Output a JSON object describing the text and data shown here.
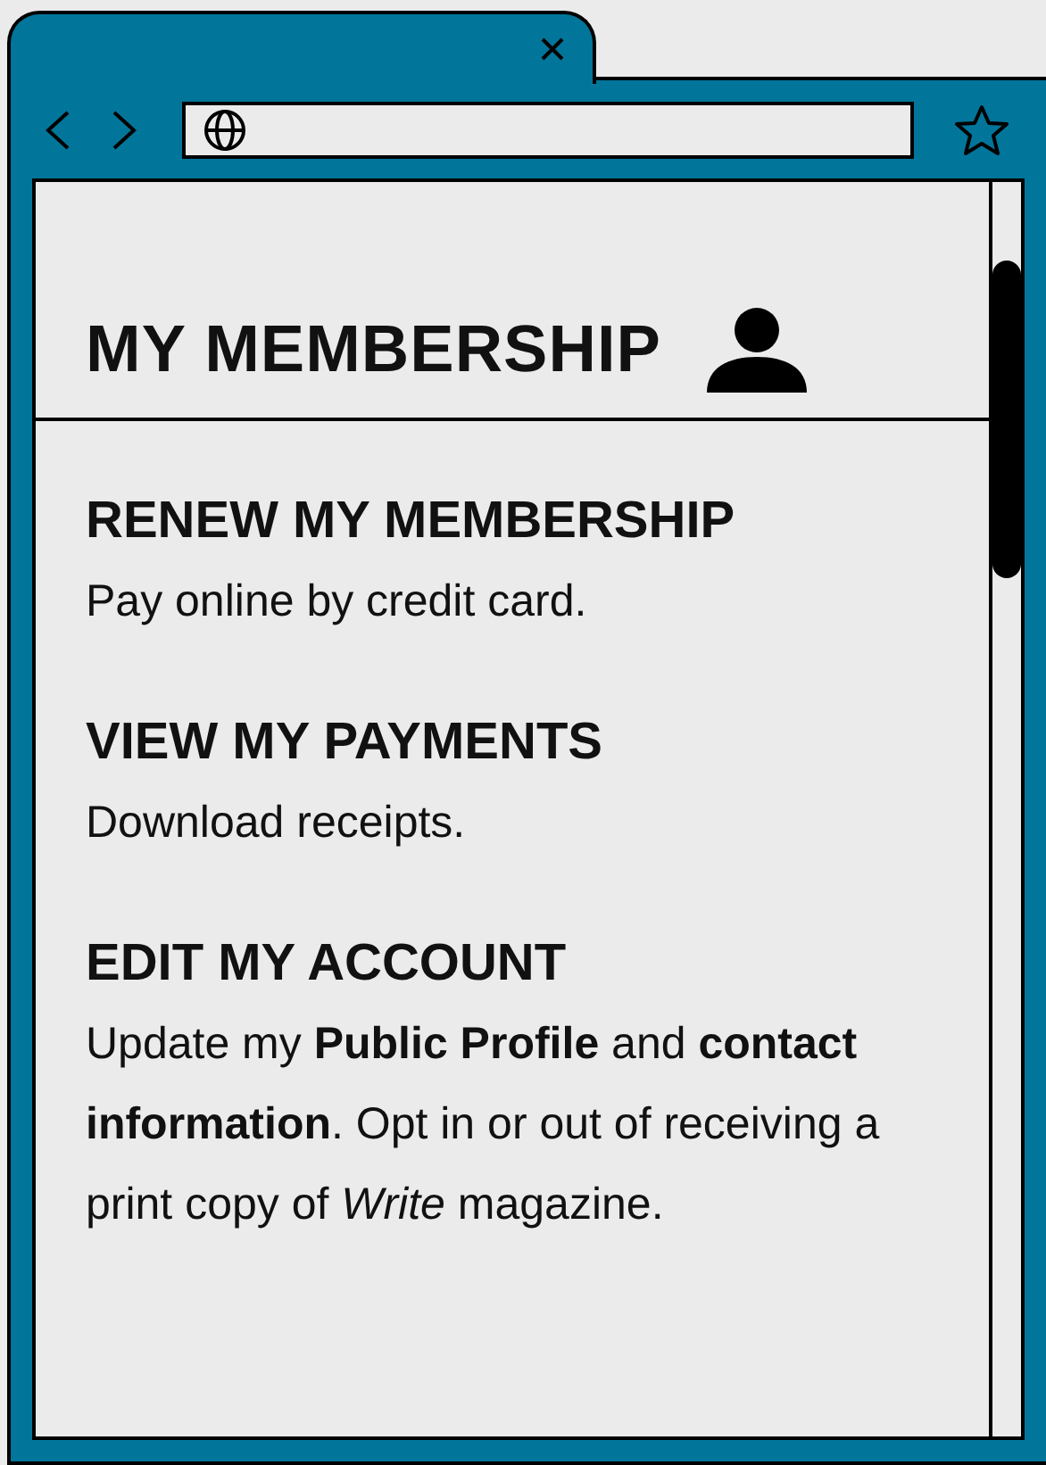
{
  "page": {
    "title": "MY MEMBERSHIP",
    "sections": [
      {
        "title": "RENEW MY MEMBERSHIP",
        "text": "Pay online by credit card."
      },
      {
        "title": "VIEW MY PAYMENTS",
        "text": "Download receipts."
      },
      {
        "title": "EDIT MY ACCOUNT",
        "text": "Update my **Public Profile** and **contact information**. Opt in or out of receiving a print copy of *Write* magazine."
      }
    ]
  }
}
